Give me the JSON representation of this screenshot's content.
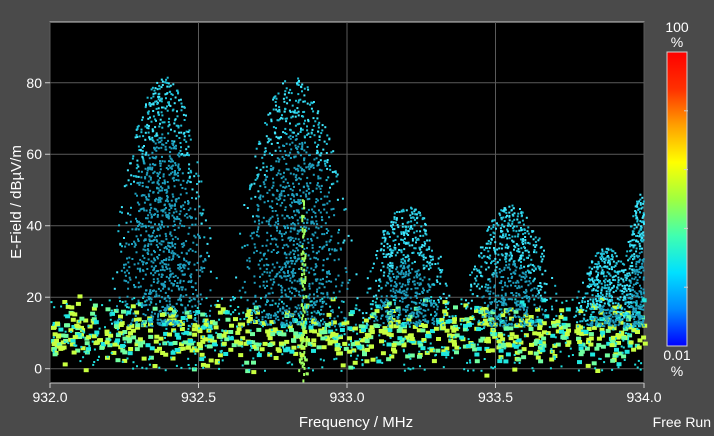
{
  "chart_data": {
    "type": "heatmap",
    "subtype": "persistence spectrum",
    "xlabel": "Frequency / MHz",
    "ylabel": "E-Field / dBµV/m",
    "xlim": [
      932.0,
      934.0
    ],
    "ylim": [
      -4,
      97
    ],
    "x_ticks": [
      "932.0",
      "932.5",
      "933.0",
      "933.5",
      "934.0"
    ],
    "x_tick_values": [
      932.0,
      932.5,
      933.0,
      933.5,
      934.0
    ],
    "y_ticks": [
      "0",
      "20",
      "40",
      "60",
      "80"
    ],
    "y_tick_values": [
      0,
      20,
      40,
      60,
      80
    ],
    "grid": true,
    "noise_floor": {
      "level": 10,
      "spread": 8
    },
    "signals": [
      {
        "center": 932.38,
        "width": 0.25,
        "peak": 80
      },
      {
        "center": 932.82,
        "width": 0.3,
        "peak": 80
      },
      {
        "center": 933.2,
        "width": 0.22,
        "peak": 44
      },
      {
        "center": 933.55,
        "width": 0.23,
        "peak": 44
      },
      {
        "center": 933.87,
        "width": 0.16,
        "peak": 32
      },
      {
        "center": 934.0,
        "width": 0.12,
        "peak": 48
      }
    ],
    "carrier": {
      "frequency": 932.85,
      "peak": 48
    },
    "colorbar": {
      "top_value": "100",
      "top_unit": "%",
      "bottom_value": "0.01",
      "bottom_unit": "%",
      "colors": [
        "#0000ff",
        "#0088ff",
        "#00e0ff",
        "#40ffb0",
        "#a0ff40",
        "#ffff00",
        "#ffa000",
        "#ff3000",
        "#ff0000"
      ]
    }
  },
  "status_text": "Free Run"
}
